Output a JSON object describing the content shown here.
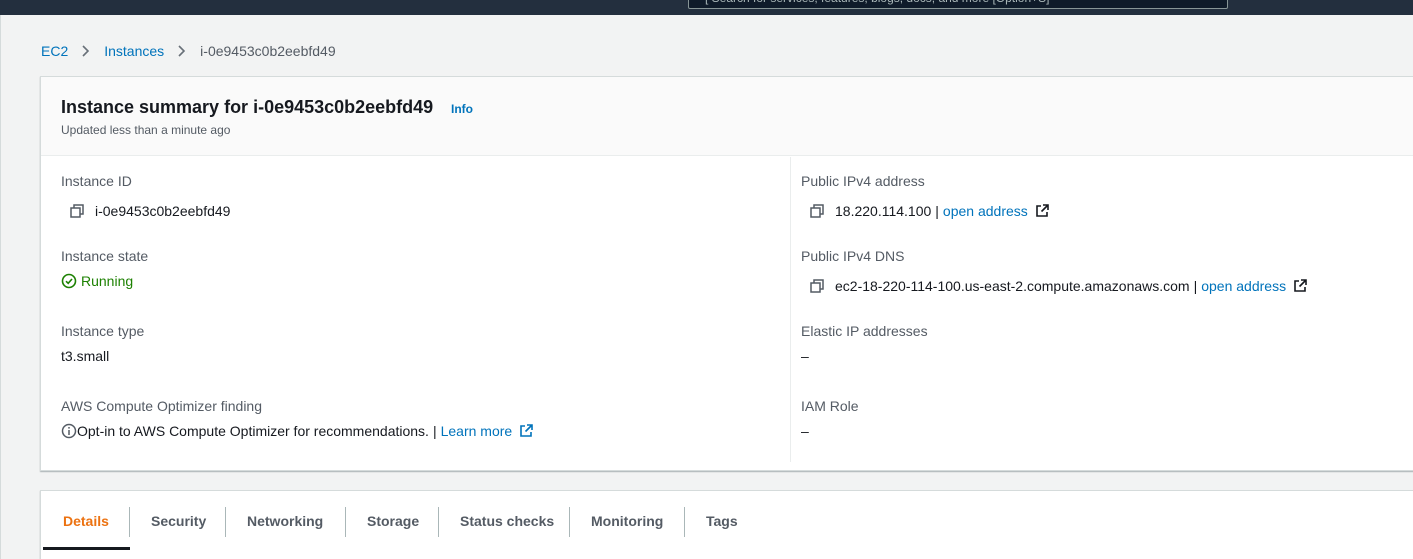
{
  "top": {
    "search_text": "[ Search for services, features, blogs, docs, and more   [Option+S]"
  },
  "breadcrumb": {
    "ec2": "EC2",
    "instances": "Instances",
    "current": "i-0e9453c0b2eebfd49"
  },
  "summary": {
    "title": "Instance summary for i-0e9453c0b2eebfd49",
    "info": "Info",
    "updated": "Updated less than a minute ago",
    "left": {
      "instance_id_label": "Instance ID",
      "instance_id_value": "i-0e9453c0b2eebfd49",
      "instance_state_label": "Instance state",
      "instance_state_value": "Running",
      "instance_type_label": "Instance type",
      "instance_type_value": "t3.small",
      "optimizer_label": "AWS Compute Optimizer finding",
      "optimizer_text": "Opt-in to AWS Compute Optimizer for recommendations.",
      "optimizer_pipe": "|",
      "learn_more": "Learn more"
    },
    "right": {
      "ipv4_label": "Public IPv4 address",
      "ipv4_value": "18.220.114.100",
      "ipv4_pipe": "|",
      "ipv4_open": "open address",
      "dns_label": "Public IPv4 DNS",
      "dns_value": "ec2-18-220-114-100.us-east-2.compute.amazonaws.com",
      "dns_pipe": "|",
      "dns_open": "open address",
      "elastic_label": "Elastic IP addresses",
      "elastic_value": "–",
      "iam_label": "IAM Role",
      "iam_value": "–"
    }
  },
  "tabs": [
    {
      "label": "Details",
      "active": true
    },
    {
      "label": "Security",
      "active": false
    },
    {
      "label": "Networking",
      "active": false
    },
    {
      "label": "Storage",
      "active": false
    },
    {
      "label": "Status checks",
      "active": false
    },
    {
      "label": "Monitoring",
      "active": false
    },
    {
      "label": "Tags",
      "active": false
    }
  ],
  "colors": {
    "link": "#0073bb",
    "running": "#1d8102",
    "active_tab": "#ec7211",
    "topbar": "#232f3e"
  },
  "icons": [
    "copy-icon",
    "external-link-icon",
    "check-circle-icon",
    "info-circle-icon",
    "chevron-right-icon"
  ]
}
